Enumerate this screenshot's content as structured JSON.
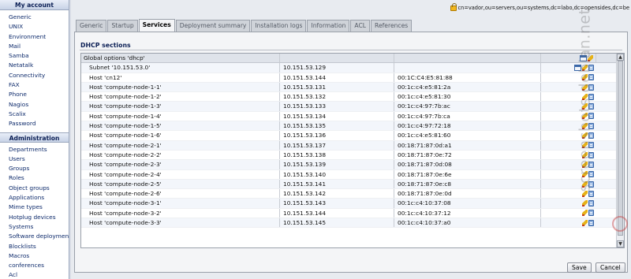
{
  "sidebar": {
    "account_heading": "My account",
    "account_items": [
      "Generic",
      "UNIX",
      "Environment",
      "Mail",
      "Samba",
      "Netatalk",
      "Connectivity",
      "FAX",
      "Phone",
      "Nagios",
      "Scalix",
      "Password"
    ],
    "admin_heading": "Administration",
    "admin_items": [
      "Departments",
      "Users",
      "Groups",
      "Roles",
      "Object groups",
      "Applications",
      "Mime types",
      "Hotplug devices",
      "Systems",
      "Software deployment",
      "Blocklists",
      "Macros",
      "conferences",
      "Acl"
    ]
  },
  "topbar": {
    "dn": "cn=vador,ou=servers,ou=systems,dc=labo,dc=opensides,dc=be",
    "lock_icon": "lock-icon"
  },
  "tabs": [
    {
      "label": "Generic",
      "active": false
    },
    {
      "label": "Startup",
      "active": false
    },
    {
      "label": "Services",
      "active": true
    },
    {
      "label": "Deployment summary",
      "active": false
    },
    {
      "label": "Installation logs",
      "active": false
    },
    {
      "label": "Information",
      "active": false
    },
    {
      "label": "ACL",
      "active": false
    },
    {
      "label": "References",
      "active": false
    }
  ],
  "section_title": "DHCP sections",
  "table": {
    "header": {
      "name": "Global options 'dhcp'",
      "ip": "",
      "mac": ""
    },
    "rows": [
      {
        "name": "Subnet '10.151.53.0'",
        "ip": "10.151.53.129",
        "mac": "",
        "add": true
      },
      {
        "name": "Host 'cn12'",
        "ip": "10.151.53.144",
        "mac": "00:1C:C4:E5:81:88"
      },
      {
        "name": "Host 'compute-node-1-1'",
        "ip": "10.151.53.131",
        "mac": "00:1c:c4:e5:81:2a"
      },
      {
        "name": "Host 'compute-node-1-2'",
        "ip": "10.151.53.132",
        "mac": "00:1c:c4:e5:81:30"
      },
      {
        "name": "Host 'compute-node-1-3'",
        "ip": "10.151.53.133",
        "mac": "00:1c:c4:97:7b:ac"
      },
      {
        "name": "Host 'compute-node-1-4'",
        "ip": "10.151.53.134",
        "mac": "00:1c:c4:97:7b:ca"
      },
      {
        "name": "Host 'compute-node-1-5'",
        "ip": "10.151.53.135",
        "mac": "00:1c:c4:97:72:18"
      },
      {
        "name": "Host 'compute-node-1-6'",
        "ip": "10.151.53.136",
        "mac": "00:1c:c4:e5:81:60"
      },
      {
        "name": "Host 'compute-node-2-1'",
        "ip": "10.151.53.137",
        "mac": "00:18:71:87:0d:a1"
      },
      {
        "name": "Host 'compute-node-2-2'",
        "ip": "10.151.53.138",
        "mac": "00:18:71:87:0e:72"
      },
      {
        "name": "Host 'compute-node-2-3'",
        "ip": "10.151.53.139",
        "mac": "00:18:71:87:0d:08"
      },
      {
        "name": "Host 'compute-node-2-4'",
        "ip": "10.151.53.140",
        "mac": "00:18:71:87:0e:6e"
      },
      {
        "name": "Host 'compute-node-2-5'",
        "ip": "10.151.53.141",
        "mac": "00:18:71:87:0e:c8"
      },
      {
        "name": "Host 'compute-node-2-6'",
        "ip": "10.151.53.142",
        "mac": "00:18:71:87:0e:0d"
      },
      {
        "name": "Host 'compute-node-3-1'",
        "ip": "10.151.53.143",
        "mac": "00:1c:c4:10:37:08"
      },
      {
        "name": "Host 'compute-node-3-2'",
        "ip": "10.151.53.144",
        "mac": "00:1c:c4:10:37:12"
      },
      {
        "name": "Host 'compute-node-3-3'",
        "ip": "10.151.53.145",
        "mac": "00:1c:c4:10:37:a0"
      }
    ]
  },
  "buttons": {
    "save": "Save",
    "cancel": "Cancel"
  },
  "watermark": "screenshots.debian.net",
  "colors": {
    "heading": "#0b1f55",
    "link": "#0d2a6b",
    "panel": "#f4f5f7",
    "tab_inactive": "#cfd3d9"
  }
}
